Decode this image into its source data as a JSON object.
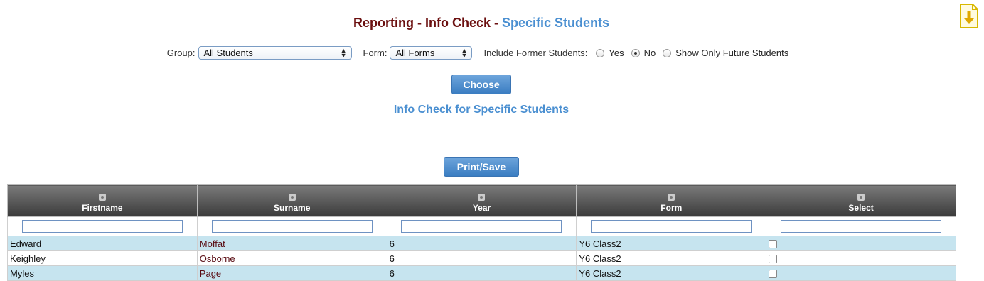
{
  "header": {
    "title_prefix": "Reporting - Info Check - ",
    "title_highlight": "Specific Students",
    "icon": "download-document-icon"
  },
  "filters": {
    "group_label": "Group:",
    "group_value": "All Students",
    "form_label": "Form:",
    "form_value": "All Forms",
    "former_label": "Include Former Students:",
    "options": [
      {
        "label": "Yes",
        "selected": false
      },
      {
        "label": "No",
        "selected": true
      },
      {
        "label": "Show Only Future Students",
        "selected": false
      }
    ]
  },
  "actions": {
    "choose_label": "Choose",
    "print_label": "Print/Save"
  },
  "subtitle": "Info Check for Specific Students",
  "table": {
    "columns": [
      "Firstname",
      "Surname",
      "Year",
      "Form",
      "Select"
    ],
    "rows": [
      {
        "firstname": "Edward",
        "surname": "Moffat",
        "year": "6",
        "form": "Y6 Class2"
      },
      {
        "firstname": "Keighley",
        "surname": "Osborne",
        "year": "6",
        "form": "Y6 Class2"
      },
      {
        "firstname": "Myles",
        "surname": "Page",
        "year": "6",
        "form": "Y6 Class2"
      }
    ]
  },
  "colors": {
    "title_dark": "#6b0f0f",
    "accent_blue": "#4a8fd1",
    "row_highlight": "#c6e4ef",
    "button_blue": "#3a7dc2"
  }
}
